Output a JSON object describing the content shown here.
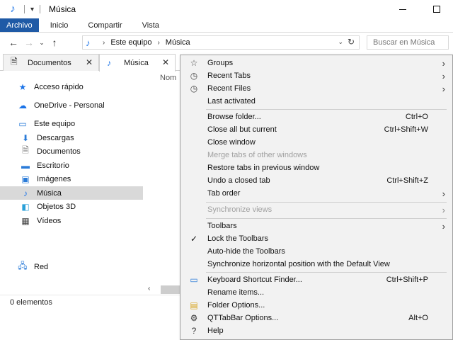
{
  "window": {
    "title": "Música",
    "app_icon": "music-note-icon",
    "quick_access_glyph": "▾"
  },
  "ribbon": {
    "tabs": [
      "Archivo",
      "Inicio",
      "Compartir",
      "Vista"
    ]
  },
  "address": {
    "crumbs": [
      "Este equipo",
      "Música"
    ],
    "search_placeholder": "Buscar en Música"
  },
  "tabs": [
    {
      "label": "Documentos",
      "icon": "document-icon"
    },
    {
      "label": "Música",
      "icon": "music-note-icon"
    }
  ],
  "nav": {
    "quick_access": "Acceso rápido",
    "onedrive": "OneDrive - Personal",
    "this_pc": "Este equipo",
    "downloads": "Descargas",
    "documents": "Documentos",
    "desktop": "Escritorio",
    "images": "Imágenes",
    "music": "Música",
    "objects3d": "Objetos 3D",
    "videos": "Vídeos",
    "network": "Red"
  },
  "content": {
    "column_name": "Nom"
  },
  "status": {
    "items": "0 elementos"
  },
  "menu": {
    "groups": "Groups",
    "recent_tabs": "Recent Tabs",
    "recent_files": "Recent Files",
    "last_activated": "Last activated",
    "browse_folder": "Browse folder...",
    "browse_folder_sc": "Ctrl+O",
    "close_all_but_current": "Close all but current",
    "close_all_but_current_sc": "Ctrl+Shift+W",
    "close_window": "Close window",
    "merge_tabs": "Merge tabs of other windows",
    "restore_tabs": "Restore tabs in previous window",
    "undo_closed_tab": "Undo a closed tab",
    "undo_closed_tab_sc": "Ctrl+Shift+Z",
    "tab_order": "Tab order",
    "sync_views": "Synchronize views",
    "toolbars": "Toolbars",
    "lock_toolbars": "Lock the Toolbars",
    "autohide_toolbars": "Auto-hide the Toolbars",
    "sync_horizontal": "Synchronize horizontal position with the Default View",
    "shortcut_finder": "Keyboard Shortcut Finder...",
    "shortcut_finder_sc": "Ctrl+Shift+P",
    "rename_items": "Rename items...",
    "folder_options": "Folder Options...",
    "qttabbar_options": "QTTabBar Options...",
    "qttabbar_options_sc": "Alt+O",
    "help": "Help"
  }
}
